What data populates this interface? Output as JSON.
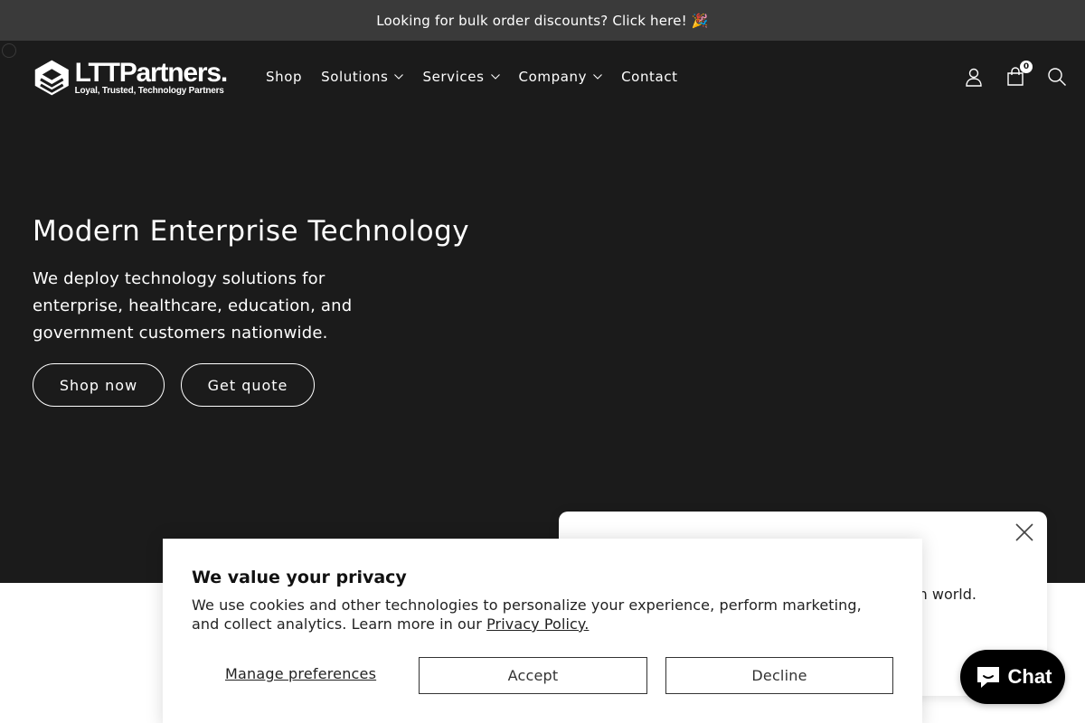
{
  "announcement": {
    "text": "Looking for bulk order discounts? Click here! 🎉"
  },
  "header": {
    "logo": {
      "name": "LTTPartners.",
      "tagline": "Loyal, Trusted, Technology Partners"
    },
    "nav": [
      {
        "label": "Shop",
        "has_dropdown": false
      },
      {
        "label": "Solutions",
        "has_dropdown": true
      },
      {
        "label": "Services",
        "has_dropdown": true
      },
      {
        "label": "Company",
        "has_dropdown": true
      },
      {
        "label": "Contact",
        "has_dropdown": false
      }
    ],
    "icons": [
      "account-icon",
      "cart-icon",
      "search-icon"
    ],
    "cart_count": "0"
  },
  "hero": {
    "title": "Modern Enterprise Technology",
    "text": "We deploy technology solutions for enterprise, healthcare, education, and government customers nationwide.",
    "buttons": {
      "shop": "Shop now",
      "quote": "Get quote"
    }
  },
  "popup": {
    "visible_text": "n world."
  },
  "cookie_banner": {
    "title": "We value your privacy",
    "body": "We use cookies and other technologies to personalize your experience, perform marketing, and collect analytics. Learn more in our ",
    "policy_link": "Privacy Policy.",
    "manage": "Manage preferences",
    "accept": "Accept",
    "decline": "Decline"
  },
  "chat": {
    "label": "Chat"
  },
  "colors": {
    "announcement_bg": "#3a3a3a",
    "hero_bg": "#1b1b1b",
    "chat_bg": "#000000"
  }
}
